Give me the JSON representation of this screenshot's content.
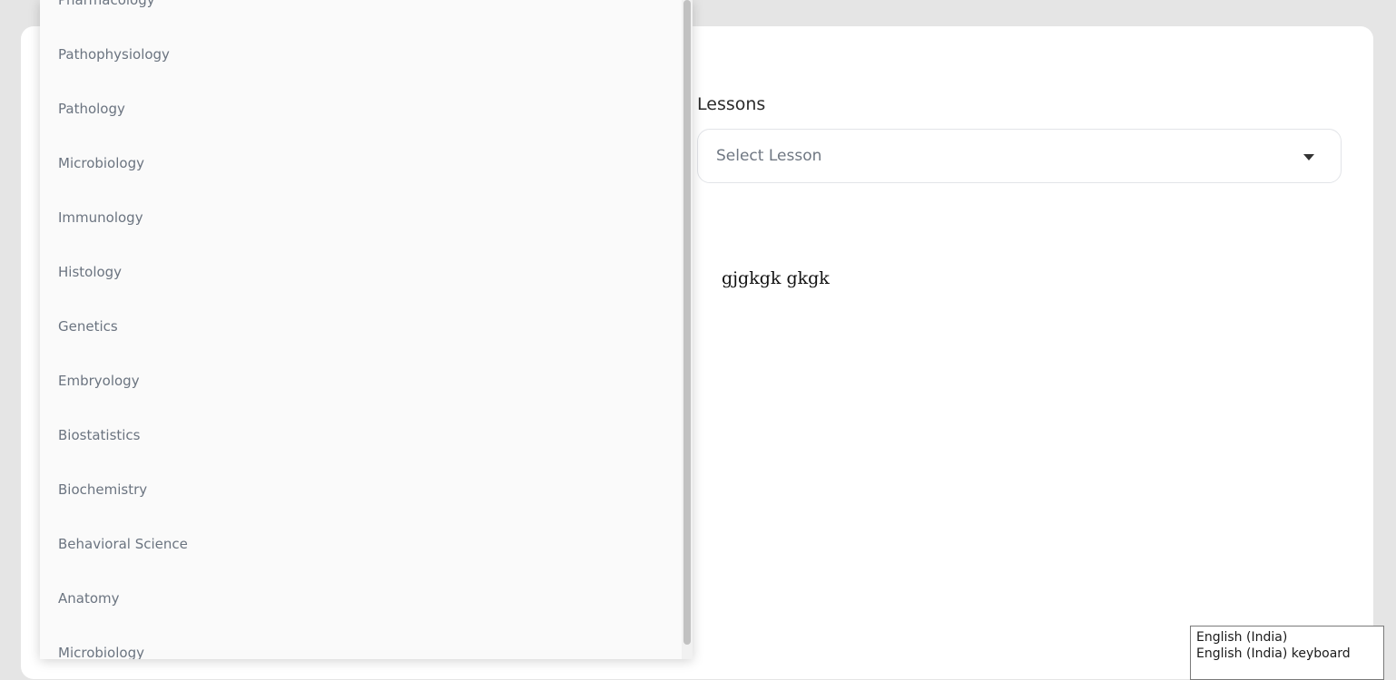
{
  "lessons": {
    "label": "Lessons",
    "placeholder": "Select Lesson"
  },
  "content": {
    "text": "gjgkgk gkgk"
  },
  "subjects": {
    "items": [
      "Pharmacology",
      "Pathophysiology",
      "Pathology",
      "Microbiology",
      "Immunology",
      "Histology",
      "Genetics",
      "Embryology",
      "Biostatistics",
      "Biochemistry",
      "Behavioral Science",
      "Anatomy",
      "Microbiology"
    ]
  },
  "language_popup": {
    "language": "English (India)",
    "keyboard": "English (India) keyboard"
  },
  "colors": {
    "page_bg": "#e5e5e5",
    "card_bg": "#ffffff",
    "dropdown_bg": "#fafafa",
    "item_text": "#6b7480"
  },
  "icons": {
    "select_caret": "caret-down-icon"
  }
}
